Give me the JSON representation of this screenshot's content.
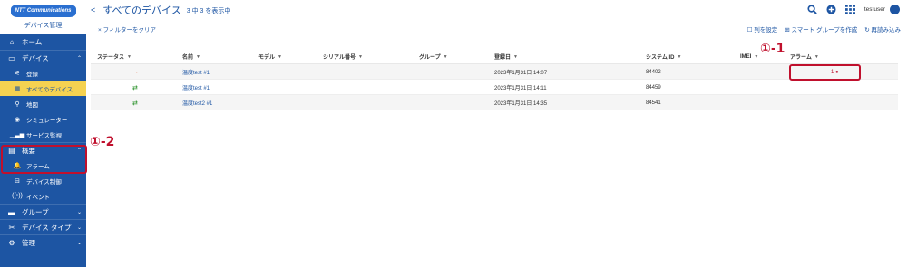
{
  "brand": {
    "logo_text": "NTT Communications",
    "subtitle": "デバイス管理"
  },
  "sidebar": {
    "items": [
      {
        "label": "ホーム",
        "icon": "home-icon",
        "glyph": "⌂"
      },
      {
        "label": "デバイス",
        "icon": "device-icon",
        "glyph": "▭",
        "chevron": "⌃"
      },
      {
        "label": "登録",
        "icon": "satellite-icon",
        "glyph": "⚟",
        "sub": true
      },
      {
        "label": "すべてのデバイス",
        "icon": "grid-icon",
        "glyph": "▦",
        "sub": true,
        "active": true
      },
      {
        "label": "地図",
        "icon": "map-pin-icon",
        "glyph": "⚲",
        "sub": true
      },
      {
        "label": "シミュレーター",
        "icon": "simulator-icon",
        "glyph": "◉",
        "sub": true
      },
      {
        "label": "サービス監視",
        "icon": "signal-icon",
        "glyph": "▁▃▅",
        "sub": true
      },
      {
        "label": "概要",
        "icon": "overview-icon",
        "glyph": "▤",
        "chevron": "⌃"
      },
      {
        "label": "アラーム",
        "icon": "bell-icon",
        "glyph": "🔔",
        "sub": true
      },
      {
        "label": "デバイス制御",
        "icon": "control-icon",
        "glyph": "⊟",
        "sub": true
      },
      {
        "label": "イベント",
        "icon": "event-icon",
        "glyph": "((•))",
        "sub": true
      },
      {
        "label": "グループ",
        "icon": "folder-icon",
        "glyph": "▬",
        "chevron": "⌄"
      },
      {
        "label": "デバイス タイプ",
        "icon": "device-type-icon",
        "glyph": "✂",
        "chevron": "⌄"
      },
      {
        "label": "管理",
        "icon": "admin-icon",
        "glyph": "⚙",
        "chevron": "⌄"
      }
    ]
  },
  "header": {
    "collapse": "<",
    "title": "すべてのデバイス",
    "count": "3 中 3 を表示中",
    "user": "testuser"
  },
  "toolbar": {
    "clear_filter": "× フィルターをクリア",
    "configure_columns": "☐ 列を設定",
    "smart_group": "⊞ スマート グループを作成",
    "reload": "↻ 再読み込み"
  },
  "table": {
    "headers": [
      "ステータス",
      "名前",
      "モデル",
      "シリアル番号",
      "グループ",
      "登録日",
      "システム ID",
      "IMEI",
      "アラーム"
    ],
    "filter_glyph": "▼",
    "rows": [
      {
        "status": "→",
        "status_color": "#e05a2a",
        "name": "温度test #1",
        "registered": "2023年1月31日 14:07",
        "system_id": "84402",
        "alarm": "1 ●"
      },
      {
        "status": "⇄",
        "status_color": "#3a9a3a",
        "name": "温度test #1",
        "registered": "2023年1月31日 14:11",
        "system_id": "84459",
        "alarm": ""
      },
      {
        "status": "⇄",
        "status_color": "#3a9a3a",
        "name": "温度test2 #1",
        "registered": "2023年1月31日 14:35",
        "system_id": "84541",
        "alarm": ""
      }
    ]
  },
  "annotations": {
    "label_1": "①-1",
    "label_2": "①-2"
  },
  "colors": {
    "brand_blue": "#1d55a3",
    "active_yellow": "#f5d251",
    "annotation_red": "#c0102d"
  }
}
